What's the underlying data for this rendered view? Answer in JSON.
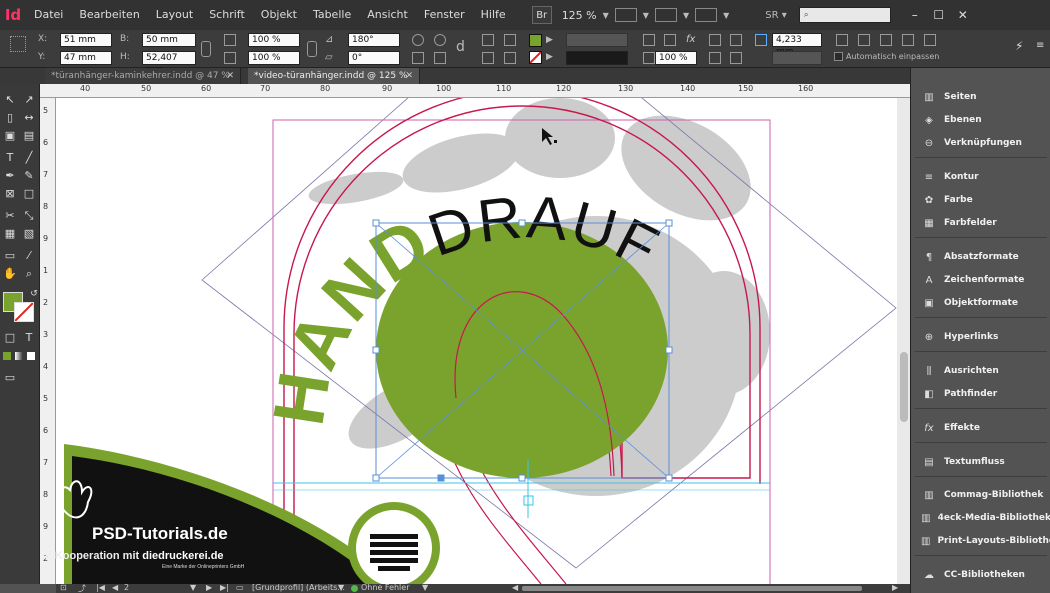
{
  "app": {
    "logo": "Id"
  },
  "menu": [
    "Datei",
    "Bearbeiten",
    "Layout",
    "Schrift",
    "Objekt",
    "Tabelle",
    "Ansicht",
    "Fenster",
    "Hilfe"
  ],
  "menubar": {
    "bridge": "Br",
    "zoom": "125 %",
    "workspace": "SR",
    "search_placeholder": ""
  },
  "window_controls": {
    "minimize": "–",
    "maximize": "☐",
    "close": "✕"
  },
  "control": {
    "x_label": "X:",
    "x_value": "51 mm",
    "y_label": "Y:",
    "y_value": "47 mm",
    "w_label": "B:",
    "w_value": "50 mm",
    "h_label": "H:",
    "h_value": "52,407 mm",
    "scale_x": "100 %",
    "scale_y": "100 %",
    "rotation": "180°",
    "shear": "0°",
    "stroke_weight": "4,233 mm",
    "opacity": "100 %",
    "auto_fit": "Automatisch einpassen",
    "fill_color": "#7aa32d"
  },
  "tabs": [
    {
      "label": "*türanhänger-kaminkehrer.indd @ 47 %",
      "active": false
    },
    {
      "label": "*video-türanhänger.indd @ 125 %",
      "active": true
    }
  ],
  "ruler": {
    "top": [
      "40",
      "50",
      "60",
      "70",
      "80",
      "90",
      "100",
      "110",
      "120",
      "130",
      "140",
      "150",
      "160"
    ],
    "left": [
      "5",
      "6",
      "7",
      "8",
      "9",
      "1",
      "2",
      "3",
      "4",
      "5",
      "6",
      "7",
      "8",
      "9",
      "2"
    ]
  },
  "artwork": {
    "word_left": "HAND",
    "word_right": "DRAUF",
    "green": "#7aa32d",
    "black_shape": "#111111",
    "hand_gray": "#cccccc",
    "frame_red": "#c8174d",
    "frame_magenta": "#cc5fb0",
    "selection_blue": "#5a8fd8"
  },
  "watermark": {
    "brand": "PSD-Tutorials.de",
    "coop_prefix": "in Kooperation mit",
    "partner": "diedruckerei.de",
    "tagline": "Eine Marke der Onlineprinters GmbH"
  },
  "status": {
    "page": "2",
    "profile": "[Grundprofil] (Arbeits...",
    "errors": "Ohne Fehler"
  },
  "panels": [
    {
      "label": "Seiten",
      "icon": "pages-icon"
    },
    {
      "label": "Ebenen",
      "icon": "layers-icon"
    },
    {
      "label": "Verknüpfungen",
      "icon": "links-icon"
    },
    {
      "label": "Kontur",
      "icon": "stroke-icon"
    },
    {
      "label": "Farbe",
      "icon": "color-icon"
    },
    {
      "label": "Farbfelder",
      "icon": "swatches-icon"
    },
    {
      "label": "Absatzformate",
      "icon": "paragraph-styles-icon"
    },
    {
      "label": "Zeichenformate",
      "icon": "character-styles-icon"
    },
    {
      "label": "Objektformate",
      "icon": "object-styles-icon"
    },
    {
      "label": "Hyperlinks",
      "icon": "hyperlinks-icon"
    },
    {
      "label": "Ausrichten",
      "icon": "align-icon"
    },
    {
      "label": "Pathfinder",
      "icon": "pathfinder-icon"
    },
    {
      "label": "Effekte",
      "icon": "effects-icon"
    },
    {
      "label": "Textumfluss",
      "icon": "text-wrap-icon"
    },
    {
      "label": "Commag-Bibliothek",
      "icon": "library-icon"
    },
    {
      "label": "4eck-Media-Bibliothek",
      "icon": "library-icon"
    },
    {
      "label": "Print-Layouts-Bibliothek",
      "icon": "library-icon"
    },
    {
      "label": "CC-Bibliotheken",
      "icon": "cc-libraries-icon"
    }
  ]
}
